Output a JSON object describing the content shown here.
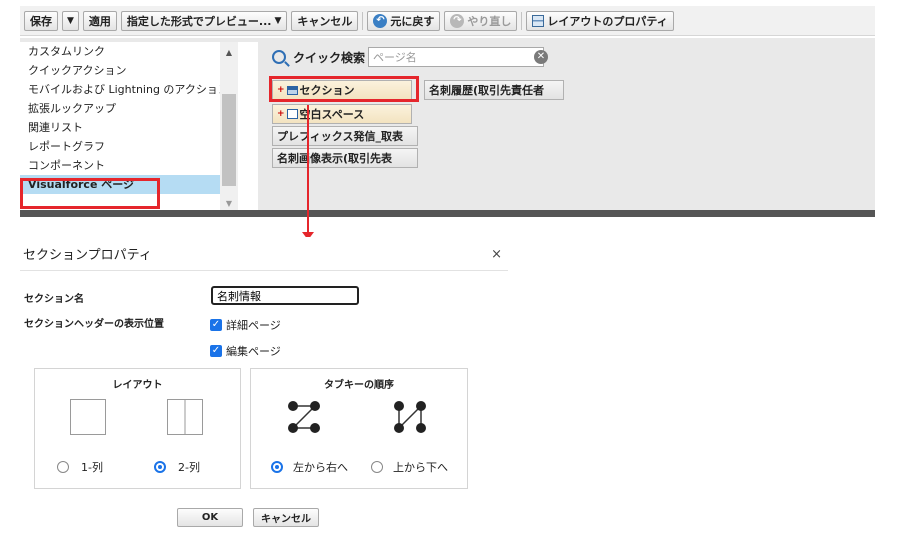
{
  "toolbar": {
    "save_label": "保存",
    "apply_label": "適用",
    "preview_label": "指定した形式でプレビュー...",
    "cancel_label": "キャンセル",
    "undo_label": "元に戻す",
    "redo_label": "やり直し",
    "layout_props_label": "レイアウトのプロパティ"
  },
  "palette": {
    "categories": [
      {
        "label": "カスタムリンク"
      },
      {
        "label": "クイックアクション"
      },
      {
        "label": "モバイルおよび Lightning のアクション"
      },
      {
        "label": "拡張ルックアップ"
      },
      {
        "label": "関連リスト"
      },
      {
        "label": "レポートグラフ"
      },
      {
        "label": "コンポーネント"
      },
      {
        "label": "Visualforce ページ"
      }
    ],
    "selected_category": "Visualforce ページ",
    "quick_search_label": "クイック検索",
    "search_placeholder": "ページ名",
    "items": {
      "section": "セクション",
      "blank_space": "空白スペース",
      "card_history": "名刺履歴(取引先責任者",
      "prefix": "プレフィックス発信_取表",
      "card_image": "名刺画像表示(取引先表"
    }
  },
  "dialog": {
    "title": "セクションプロパティ",
    "close_symbol": "×",
    "section_name_label": "セクション名",
    "section_name_value": "名刺情報",
    "header_position_label": "セクションヘッダーの表示位置",
    "detail_page_label": "詳細ページ",
    "edit_page_label": "編集ページ",
    "detail_page_checked": true,
    "edit_page_checked": true,
    "layout_panel": {
      "title": "レイアウト",
      "option_1": "1-列",
      "option_2": "2-列",
      "selected": "2-列"
    },
    "tab_order_panel": {
      "title": "タブキーの順序",
      "option_lr": "左から右へ",
      "option_tb": "上から下へ",
      "selected": "左から右へ"
    },
    "ok_label": "OK",
    "cancel_label": "キャンセル"
  },
  "colors": {
    "highlight": "#e5262c",
    "selected_category_bg": "#b5dcf3",
    "checkbox": "#1a73e8"
  }
}
